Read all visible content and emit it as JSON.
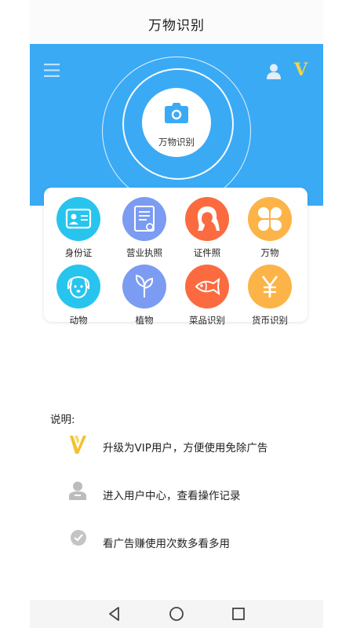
{
  "header": {
    "title": "万物识别"
  },
  "hero": {
    "scan_label": "万物识别",
    "bg_color": "#3aaaf5",
    "vip_badge": "V"
  },
  "grid": [
    {
      "label": "身份证",
      "icon": "id-card-icon",
      "color": "#27c5ee"
    },
    {
      "label": "营业执照",
      "icon": "business-license-icon",
      "color": "#7b9cf2"
    },
    {
      "label": "证件照",
      "icon": "portrait-icon",
      "color": "#fb6b3f"
    },
    {
      "label": "万物",
      "icon": "four-petal-icon",
      "color": "#fcb448"
    },
    {
      "label": "动物",
      "icon": "dog-icon",
      "color": "#27c5ee"
    },
    {
      "label": "植物",
      "icon": "sprout-icon",
      "color": "#7b9cf2"
    },
    {
      "label": "菜品识别",
      "icon": "fish-icon",
      "color": "#fb6b3f"
    },
    {
      "label": "货币识别",
      "icon": "yen-icon",
      "color": "#fcb448"
    }
  ],
  "notes": {
    "heading": "说明:",
    "items": [
      {
        "icon": "vip-v-icon",
        "text": "升级为VIP用户，方便使用免除广告"
      },
      {
        "icon": "user-icon",
        "text": "进入用户中心，查看操作记录"
      },
      {
        "icon": "check-badge-icon",
        "text": "看广告赚使用次数多看多用"
      }
    ]
  }
}
